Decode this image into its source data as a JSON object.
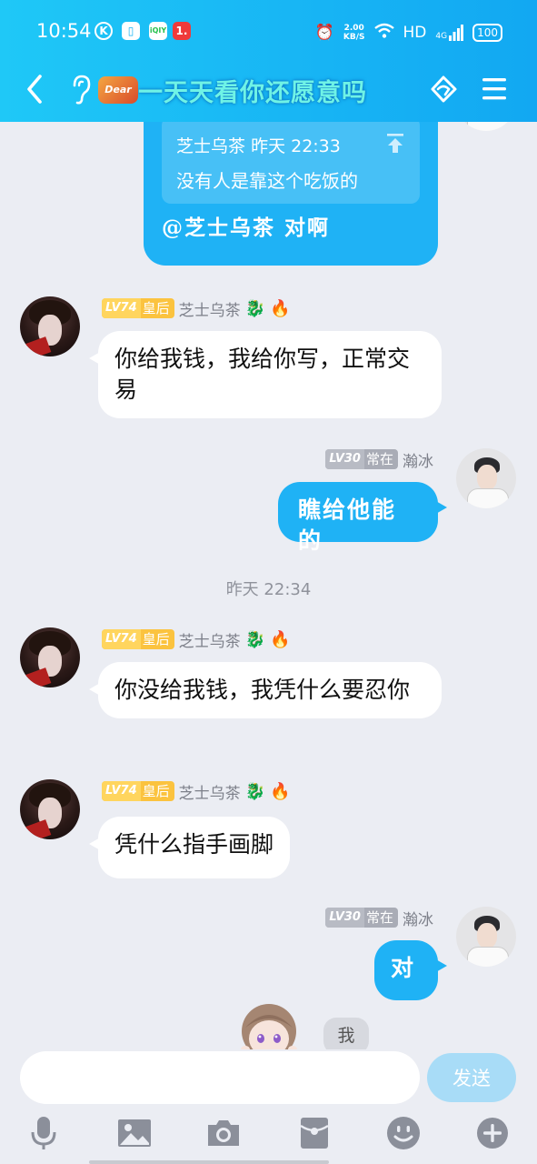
{
  "status_bar": {
    "time": "10:54",
    "net_speed_value": "2.00",
    "net_speed_unit": "KB/S",
    "hd": "HD",
    "network": "4G",
    "battery": "100"
  },
  "header": {
    "logo_text": "Dear",
    "title": "一天天看你还愿意吗",
    "accent_color": "#17b4f4"
  },
  "messages": {
    "quoted_reply": {
      "quote_author": "芝士乌茶",
      "quote_time": "昨天 22:33",
      "quote_text": "没有人是靠这个吃饭的",
      "text": "@芝士乌茶 对啊"
    },
    "msg1": {
      "level": "LV74",
      "rank": "皇后",
      "sender": "芝士乌茶",
      "text": "你给我钱，我给你写，正常交易"
    },
    "msg2": {
      "level": "LV30",
      "rank": "常在",
      "sender": "瀚冰",
      "text": "瞧给他能的"
    },
    "timestamp": "昨天 22:34",
    "msg3": {
      "level": "LV74",
      "rank": "皇后",
      "sender": "芝士乌茶",
      "text": "你没给我钱，我凭什么要忍你"
    },
    "msg4": {
      "level": "LV74",
      "rank": "皇后",
      "sender": "芝士乌茶",
      "text": "凭什么指手画脚"
    },
    "msg5": {
      "level": "LV30",
      "rank": "常在",
      "sender": "瀚冰",
      "text": "对"
    },
    "typing_bubble": "我"
  },
  "composer": {
    "placeholder": "",
    "send_label": "发送"
  }
}
